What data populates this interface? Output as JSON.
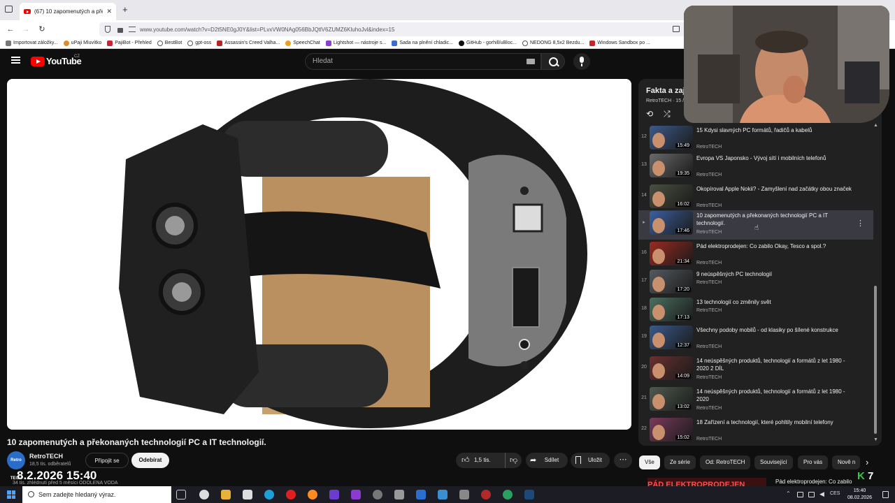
{
  "browser": {
    "tab_title": "(67) 10 zapomenutých a překon",
    "url": "www.youtube.com/watch?v=D2t5NE0gJ0Y&list=PLvxVW0NAg056BbJQtlV6ZUMZ6KluhoJvl&index=15",
    "bookmarks": [
      "Importovat záložky...",
      "uPaji Mluvítko",
      "PajiBot - Přehled",
      "BestBot",
      "gpt-oss",
      "Assassin's Creed Valha...",
      "SpeechChat",
      "Lightshot — nástroje s...",
      "Sada na plnění chladic...",
      "GitHub - gorhill/uBloc...",
      "NEDONG 8,5x2 Bezdu...",
      "Windows Sandbox po ..."
    ]
  },
  "yt": {
    "logo_text": "YouTube",
    "country": "CZ",
    "search_placeholder": "Hledat"
  },
  "video": {
    "title": "10 zapomenutých a překonaných technologií PC a IT technologií.",
    "channel": "RetroTECH",
    "avatar_text": "Retro TECH",
    "subscribers": "18,5 tis. odběratelů",
    "join_label": "Připojit se",
    "subscribe_label": "Odebírat",
    "likes": "1,5 tis.",
    "share_label": "Sdílet",
    "save_label": "Uložit",
    "views_line": "34 tis. zhlédnutí  před 5 měsíci  ODOLENA VODA",
    "overlay_clock": "8.2.2026 15:40"
  },
  "playlist": {
    "title": "Fakta a zajím",
    "subtitle": "RetroTECH · 15 / 22",
    "items": [
      {
        "index": "12",
        "title": "15 Kdysi slavných PC formátů, řadičů a kabelů",
        "channel": "RetroTECH",
        "duration": "15:49",
        "color": "#3d5a8a"
      },
      {
        "index": "13",
        "title": "Evropa VS Japonsko - Vývoj sítí i mobilních telefonů",
        "channel": "RetroTECH",
        "duration": "19:35",
        "color": "#6a6a6a"
      },
      {
        "index": "14",
        "title": "Okopíroval Apple Nokii? - Zamyšlení nad začátky obou značek",
        "channel": "RetroTECH",
        "duration": "16:02",
        "color": "#4a5040"
      },
      {
        "index": "",
        "title": "10 zapomenutých a překonaných technologií PC a IT technologií.",
        "channel": "RetroTECH",
        "duration": "17:46",
        "color": "#3b5f9e",
        "active": true
      },
      {
        "index": "16",
        "title": "Pád elektroprodejen: Co zabilo Okay, Tesco a spol.?",
        "channel": "RetroTECH",
        "duration": "21:34",
        "color": "#9a2a20"
      },
      {
        "index": "17",
        "title": "9 neúspěšných PC technologií",
        "channel": "RetroTECH",
        "duration": "17:20",
        "color": "#555a60"
      },
      {
        "index": "18",
        "title": "13 technologií co změnily svět",
        "channel": "RetroTECH",
        "duration": "17:13",
        "color": "#4a7060"
      },
      {
        "index": "19",
        "title": "Všechny podoby mobilů - od klasiky po šílené konstrukce",
        "channel": "RetroTECH",
        "duration": "12:37",
        "color": "#3a5a8a"
      },
      {
        "index": "20",
        "title": "14 neúspěšných produktů, technologií a formátů z let 1980 - 2020 2 DÍL",
        "channel": "RetroTECH",
        "duration": "14:09",
        "color": "#6a3030"
      },
      {
        "index": "21",
        "title": "14 neúspěšných produktů, technologií a formátů z let 1980 - 2020",
        "channel": "RetroTECH",
        "duration": "13:02",
        "color": "#505a50"
      },
      {
        "index": "22",
        "title": "18 Zařízení a technologií, které pohltily mobilní telefony",
        "channel": "RetroTECH",
        "duration": "15:02",
        "color": "#7a3a5a"
      }
    ]
  },
  "chips": [
    "Vše",
    "Ze série",
    "Od: RetroTECH",
    "Související",
    "Pro vás",
    "Nově n"
  ],
  "next_preview": {
    "title": "Pád elektroprodejen: Co zabilo",
    "thumb_text": "PÁD ELEKTROPRODEJEN"
  },
  "taskbar": {
    "search_placeholder": "Sem zadejte hledaný výraz.",
    "lang": "CES",
    "time": "15:40",
    "date": "08.02.2026"
  },
  "badge": {
    "letter": "K",
    "number": "7"
  }
}
